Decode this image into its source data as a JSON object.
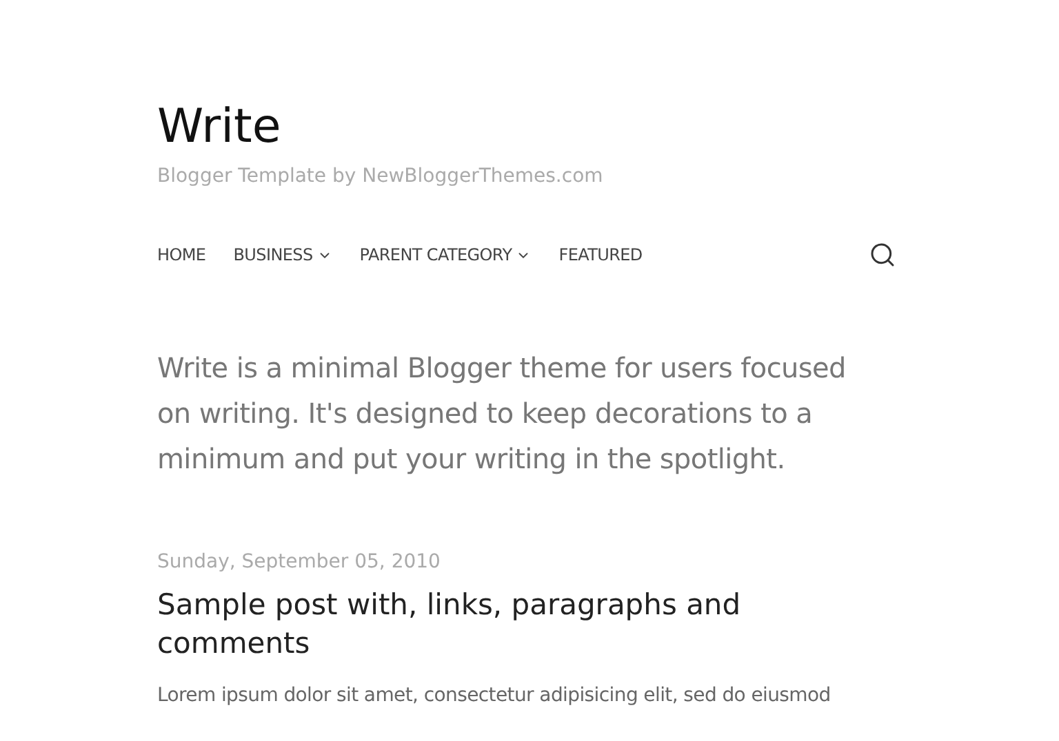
{
  "header": {
    "title": "Write",
    "tagline": "Blogger Template by NewBloggerThemes.com"
  },
  "nav": {
    "items": [
      {
        "label": "HOME",
        "has_children": false
      },
      {
        "label": "BUSINESS",
        "has_children": true
      },
      {
        "label": "PARENT CATEGORY",
        "has_children": true
      },
      {
        "label": "FEATURED",
        "has_children": false
      }
    ]
  },
  "intro": "Write is a minimal Blogger theme for users focused on writing. It's designed to keep decorations to a minimum and put your writing in the spotlight.",
  "post": {
    "date": "Sunday, September 05, 2010",
    "title": "Sample post with, links, paragraphs and comments",
    "excerpt": "Lorem ipsum dolor sit amet, consectetur adipisicing elit, sed do eiusmod"
  }
}
